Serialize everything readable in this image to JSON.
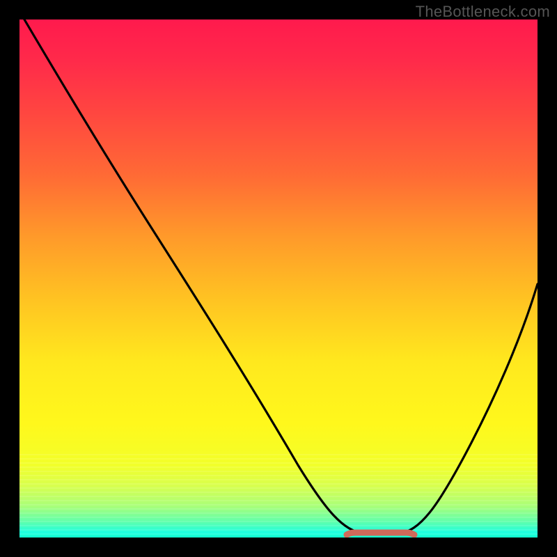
{
  "watermark": "TheBottleneck.com",
  "chart_data": {
    "type": "line",
    "title": "",
    "xlabel": "",
    "ylabel": "",
    "xlim": [
      0,
      100
    ],
    "ylim": [
      0,
      100
    ],
    "grid": false,
    "background": "rainbow-gradient-red-to-green",
    "series": [
      {
        "name": "bottleneck-curve",
        "color": "#000000",
        "x": [
          1,
          5,
          10,
          15,
          20,
          25,
          30,
          35,
          40,
          45,
          50,
          55,
          60,
          63,
          67,
          70,
          72,
          76,
          80,
          85,
          90,
          95,
          100
        ],
        "y": [
          100,
          94,
          87,
          80,
          73,
          66,
          59,
          52,
          44,
          36,
          28,
          20,
          12,
          6,
          2,
          1,
          1,
          2,
          7,
          15,
          25,
          37,
          50
        ],
        "notes": "V-shaped curve with flat minimum around x≈68–74; left arm steeper and taller than right arm"
      },
      {
        "name": "optimal-marker",
        "type": "segment",
        "color": "#d46a5a",
        "x": [
          63,
          76
        ],
        "y": [
          0.5,
          0.5
        ],
        "notes": "short horizontal marker at the valley bottom indicating optimal range"
      }
    ]
  }
}
